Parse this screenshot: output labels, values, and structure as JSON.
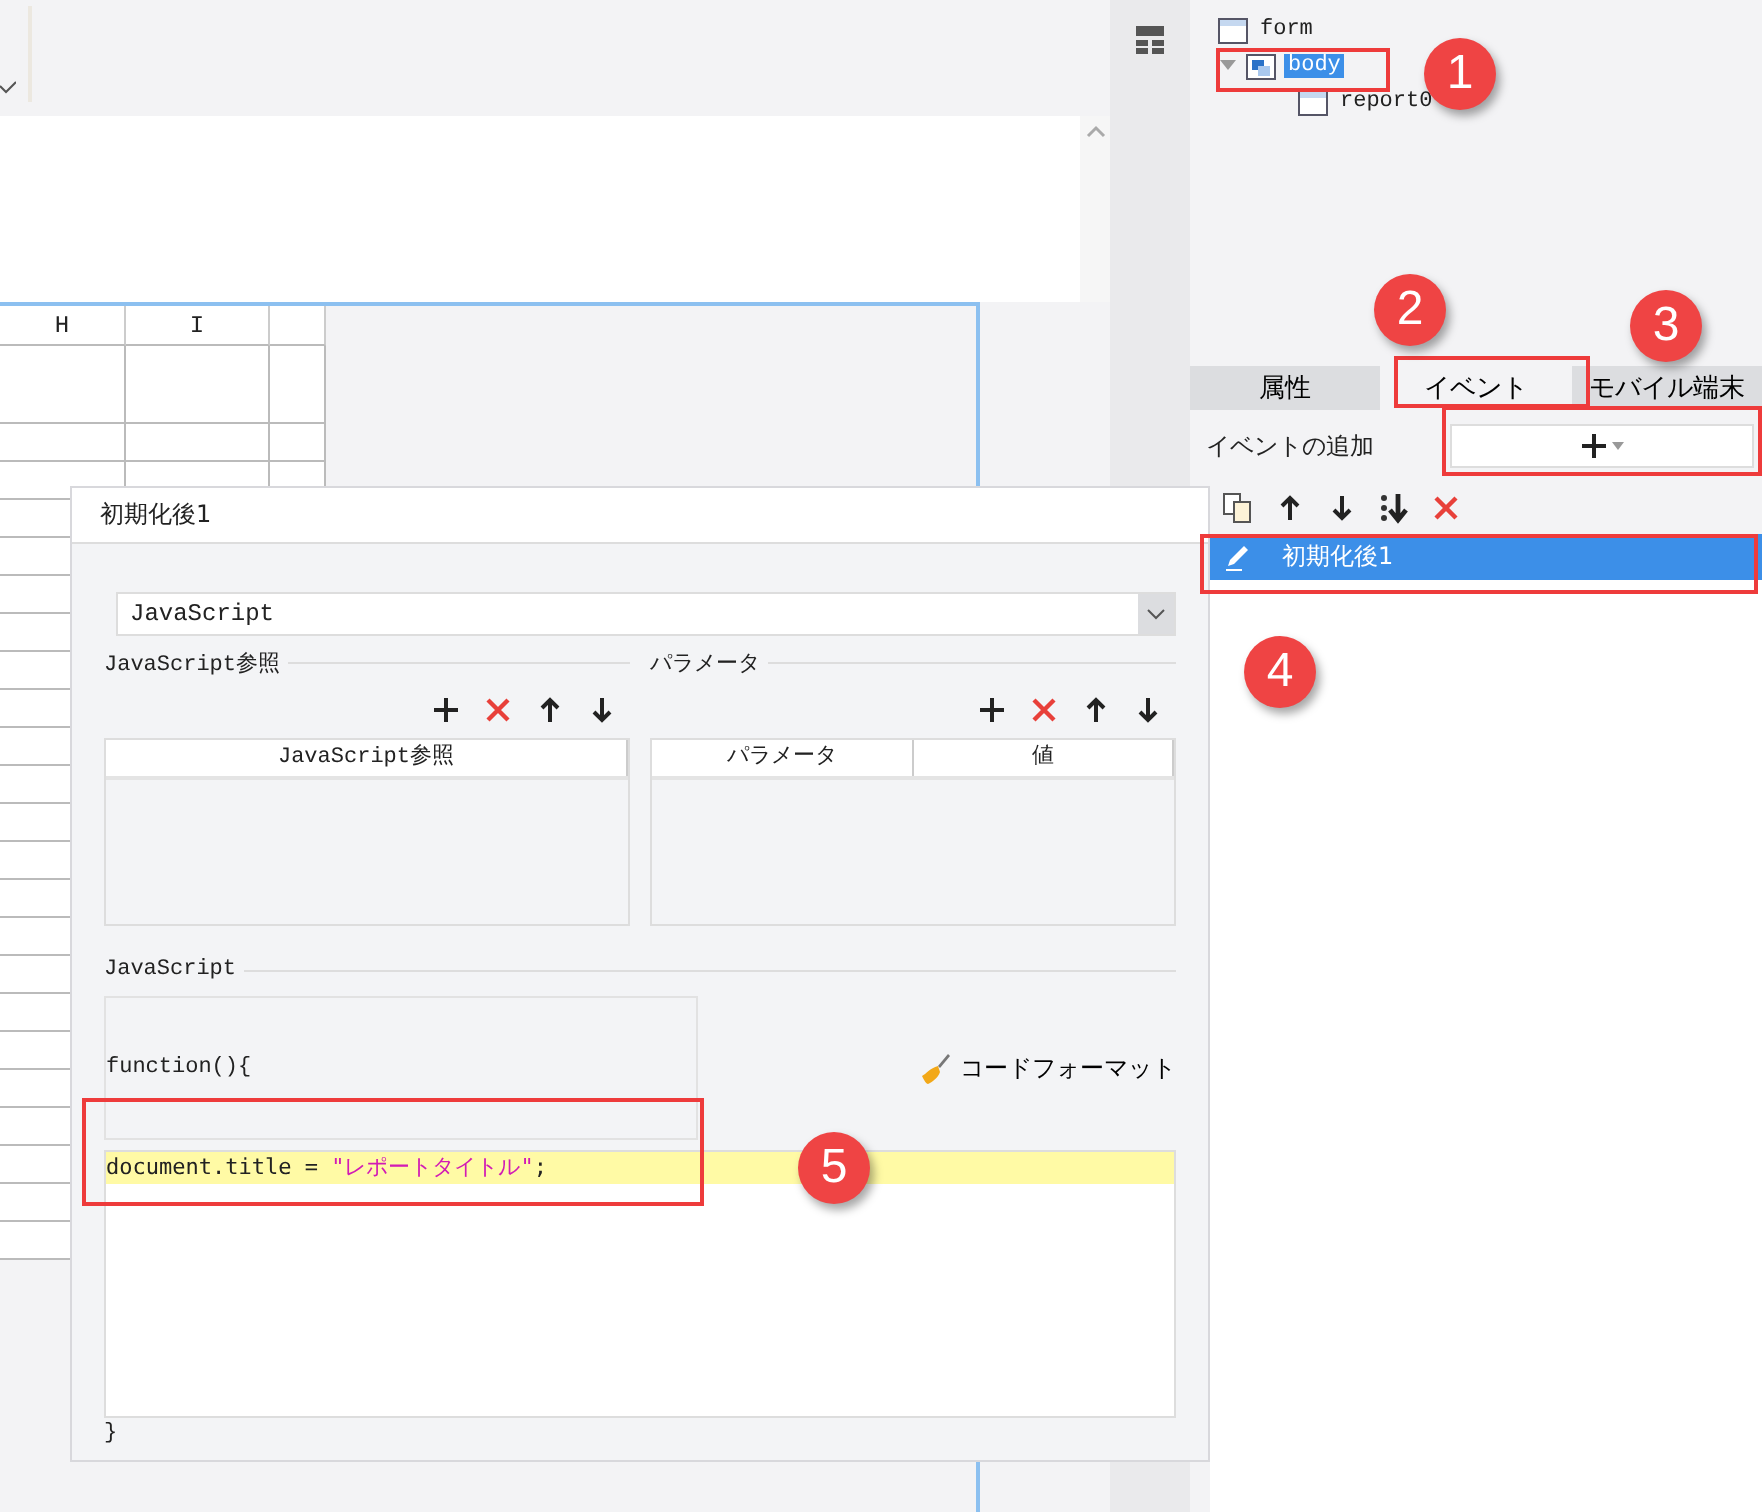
{
  "sheet": {
    "columns": [
      "H",
      "I"
    ]
  },
  "tree": [
    {
      "label": "form",
      "selected": false
    },
    {
      "label": "body",
      "selected": true,
      "expanded": true,
      "children": [
        {
          "label": "report0",
          "selected": false
        }
      ]
    }
  ],
  "tabs": [
    {
      "label": "属性",
      "selected": false
    },
    {
      "label": "イベント",
      "selected": true
    },
    {
      "label": "モバイル端末",
      "selected": false
    }
  ],
  "add_event": {
    "label": "イベントの追加"
  },
  "events": [
    {
      "label": "初期化後1",
      "selected": true
    }
  ],
  "dialog": {
    "title": "初期化後1",
    "action_type": "JavaScript",
    "references": {
      "label": "JavaScript参照",
      "columns": [
        "JavaScript参照"
      ]
    },
    "parameters": {
      "label": "パラメータ",
      "columns": [
        "パラメータ",
        "値"
      ]
    },
    "script": {
      "label": "JavaScript",
      "header": "function(){",
      "format_button": "コードフォーマット",
      "lines": [
        {
          "code": "document.title = ",
          "string": "\"レポートタイトル\"",
          "end": ";",
          "highlighted": true
        }
      ],
      "footer": "}"
    }
  },
  "annotations": [
    "1",
    "2",
    "3",
    "4",
    "5"
  ]
}
